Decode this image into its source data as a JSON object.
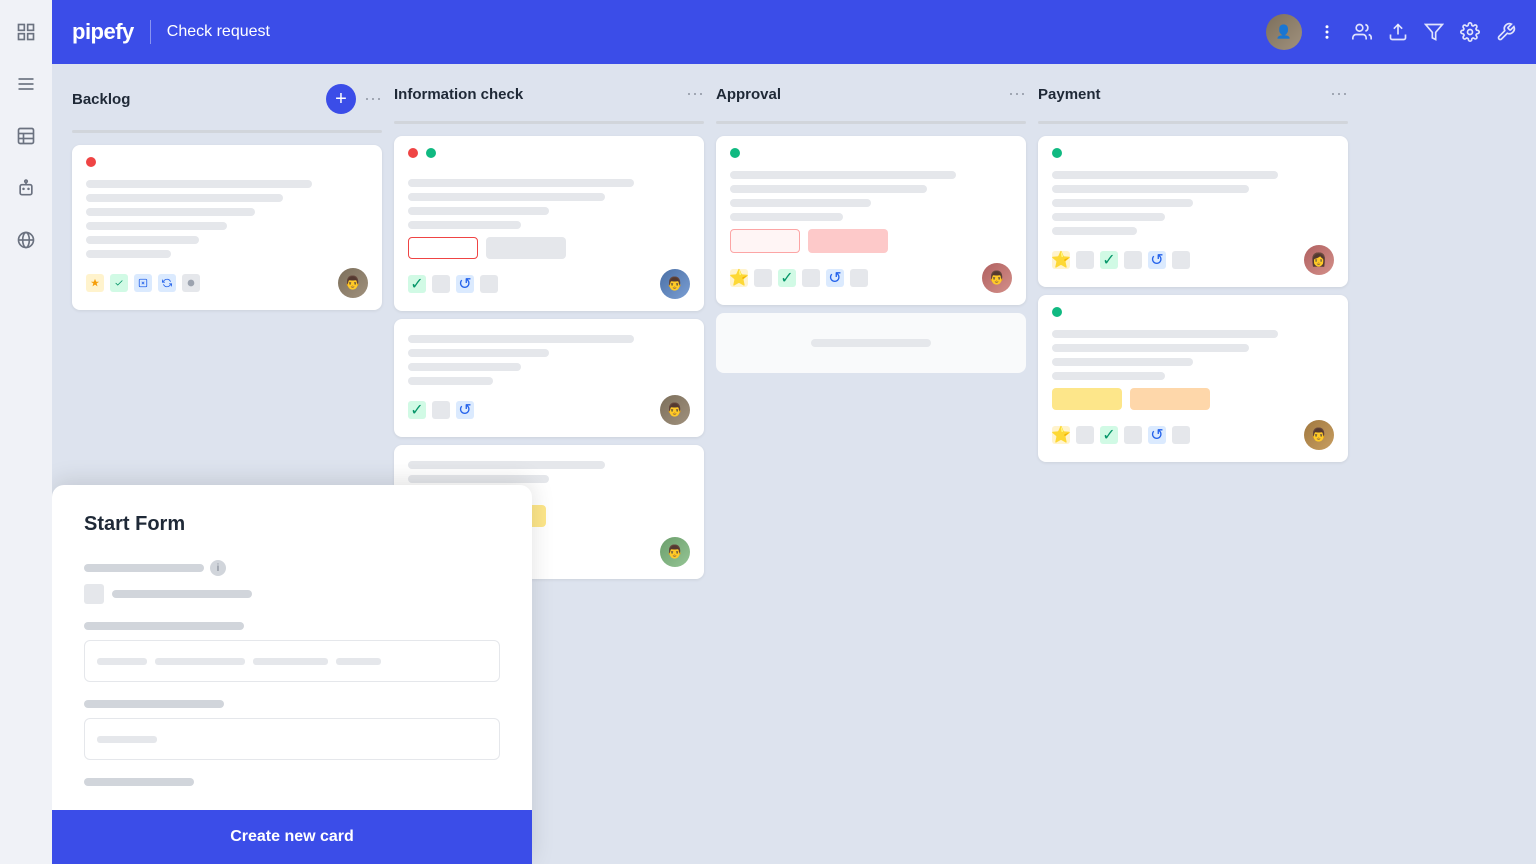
{
  "app": {
    "name": "pipefy",
    "page_title": "Check request"
  },
  "sidebar": {
    "icons": [
      {
        "name": "grid-icon",
        "symbol": "⊞"
      },
      {
        "name": "list-icon",
        "symbol": "☰"
      },
      {
        "name": "table-icon",
        "symbol": "⊡"
      },
      {
        "name": "robot-icon",
        "symbol": "⬡"
      },
      {
        "name": "globe-icon",
        "symbol": "⊕"
      }
    ]
  },
  "header": {
    "title": "Check request",
    "icons": [
      "users-icon",
      "export-icon",
      "filter-icon",
      "settings-icon",
      "wrench-icon"
    ]
  },
  "board": {
    "columns": [
      {
        "id": "backlog",
        "title": "Backlog"
      },
      {
        "id": "information-check",
        "title": "Information check"
      },
      {
        "id": "approval",
        "title": "Approval"
      },
      {
        "id": "payment",
        "title": "Payment"
      }
    ]
  },
  "form": {
    "title": "Start Form",
    "submit_label": "Create new card",
    "fields": [
      {
        "type": "text-with-info",
        "label_width": 120
      },
      {
        "type": "sub-with-icon"
      },
      {
        "type": "section-label",
        "label": ""
      },
      {
        "type": "text-input",
        "placeholder_bars": [
          50,
          100,
          80,
          50
        ]
      },
      {
        "type": "section-label2"
      },
      {
        "type": "small-input"
      },
      {
        "type": "extra-bar"
      }
    ]
  }
}
